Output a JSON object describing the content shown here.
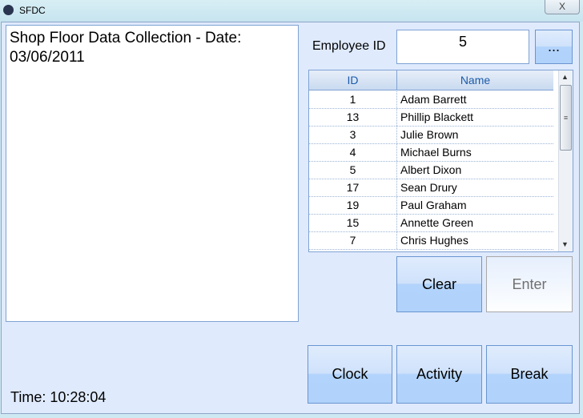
{
  "window": {
    "title": "SFDC",
    "close_label": "X"
  },
  "panel": {
    "text": "Shop Floor Data Collection - Date: 03/06/2011"
  },
  "time": "Time: 10:28:04",
  "employee": {
    "label": "Employee ID",
    "value": "5",
    "browse_label": "..."
  },
  "grid": {
    "columns": [
      "ID",
      "Name"
    ],
    "rows": [
      {
        "id": "1",
        "name": "Adam Barrett"
      },
      {
        "id": "13",
        "name": "Phillip Blackett"
      },
      {
        "id": "3",
        "name": "Julie Brown"
      },
      {
        "id": "4",
        "name": "Michael Burns"
      },
      {
        "id": "5",
        "name": "Albert Dixon"
      },
      {
        "id": "17",
        "name": "Sean Drury"
      },
      {
        "id": "19",
        "name": "Paul Graham"
      },
      {
        "id": "15",
        "name": "Annette Green"
      },
      {
        "id": "7",
        "name": "Chris Hughes"
      }
    ]
  },
  "buttons": {
    "clear": "Clear",
    "enter": "Enter",
    "clock": "Clock",
    "activity": "Activity",
    "break": "Break"
  }
}
